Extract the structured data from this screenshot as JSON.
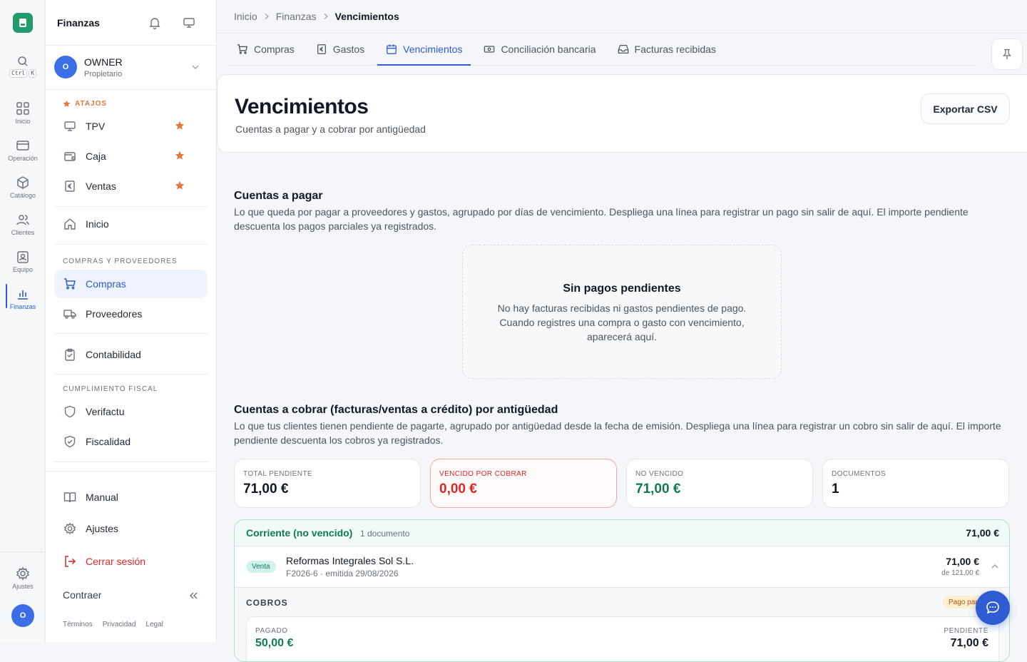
{
  "rail": {
    "kbd_ctrl": "Ctrl",
    "kbd_k": "K",
    "items": [
      {
        "label": "Inicio",
        "icon": "grid-icon"
      },
      {
        "label": "Operación",
        "icon": "card-icon"
      },
      {
        "label": "Catálogo",
        "icon": "box-icon"
      },
      {
        "label": "Clientes",
        "icon": "users-icon"
      },
      {
        "label": "Equipo",
        "icon": "badge-icon"
      },
      {
        "label": "Finanzas",
        "icon": "bar-chart-icon"
      }
    ],
    "settings_label": "Ajustes",
    "avatar": "O"
  },
  "sidebar": {
    "title": "Finanzas",
    "owner": {
      "initial": "O",
      "name": "OWNER",
      "role": "Propietario"
    },
    "shortcuts_label": "ATAJOS",
    "shortcuts": [
      "TPV",
      "Caja",
      "Ventas"
    ],
    "inicio": "Inicio",
    "section_purchases": "COMPRAS Y PROVEEDORES",
    "compras": "Compras",
    "proveedores": "Proveedores",
    "contabilidad": "Contabilidad",
    "section_fiscal": "CUMPLIMIENTO FISCAL",
    "verifactu": "Verifactu",
    "fiscalidad": "Fiscalidad",
    "manual": "Manual",
    "ajustes": "Ajustes",
    "logout": "Cerrar sesión",
    "collapse": "Contraer",
    "legal": {
      "terms": "Términos",
      "privacy": "Privacidad",
      "legal": "Legal"
    }
  },
  "breadcrumb": {
    "home": "Inicio",
    "section": "Finanzas",
    "current": "Vencimientos"
  },
  "tabs": [
    "Compras",
    "Gastos",
    "Vencimientos",
    "Conciliación bancaria",
    "Facturas recibidas"
  ],
  "header": {
    "title": "Vencimientos",
    "subtitle": "Cuentas a pagar y a cobrar por antigüedad",
    "export_label": "Exportar CSV"
  },
  "payables": {
    "title": "Cuentas a pagar",
    "description": "Lo que queda por pagar a proveedores y gastos, agrupado por días de vencimiento. Despliega una línea para registrar un pago sin salir de aquí. El importe pendiente descuenta los pagos parciales ya registrados.",
    "empty_title": "Sin pagos pendientes",
    "empty_text": "No hay facturas recibidas ni gastos pendientes de pago. Cuando registres una compra o gasto con vencimiento, aparecerá aquí."
  },
  "receivables": {
    "title": "Cuentas a cobrar (facturas/ventas a crédito) por antigüedad",
    "description": "Lo que tus clientes tienen pendiente de pagarte, agrupado por antigüedad desde la fecha de emisión. Despliega una línea para registrar un cobro sin salir de aquí. El importe pendiente descuenta los cobros ya registrados.",
    "stats": [
      {
        "label": "TOTAL PENDIENTE",
        "value": "71,00 €"
      },
      {
        "label": "VENCIDO POR COBRAR",
        "value": "0,00 €"
      },
      {
        "label": "NO VENCIDO",
        "value": "71,00 €"
      },
      {
        "label": "DOCUMENTOS",
        "value": "1"
      }
    ],
    "group": {
      "title": "Corriente (no vencido)",
      "count": "1 documento",
      "amount": "71,00 €",
      "row": {
        "badge": "Venta",
        "name": "Reformas Integrales Sol S.L.",
        "meta": "F2026-6 · emitida 29/08/2026",
        "amount": "71,00 €",
        "of_total": "de 121,00 €"
      },
      "cobros_label": "COBROS",
      "status_badge": "Pago parcial",
      "paid_label": "PAGADO",
      "paid_value": "50,00 €",
      "pending_label": "PENDIENTE",
      "pending_value": "71,00 €"
    }
  },
  "colors": {
    "accent": "#2f5bd3",
    "green": "#117a55",
    "red": "#dc2626",
    "orange": "#e8763a"
  }
}
